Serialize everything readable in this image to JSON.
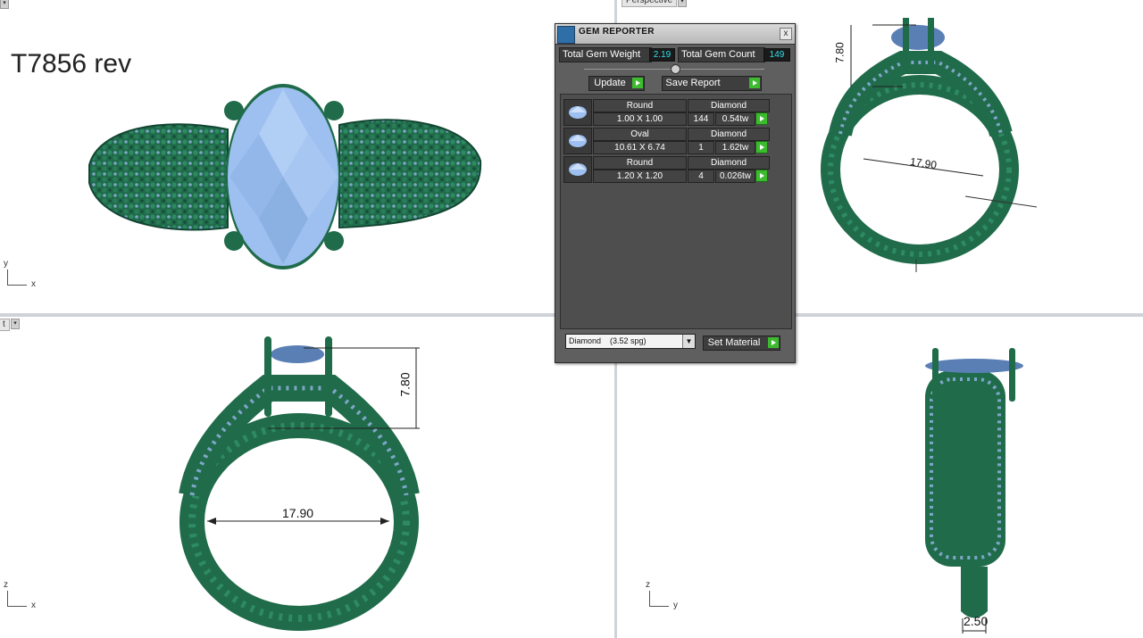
{
  "viewports": {
    "top": {
      "title": "T7856 rev",
      "axis_y": "y",
      "axis_x": "x"
    },
    "perspective": {
      "tab": "Perspective",
      "dim_height": "7.80",
      "dim_width": "17.90"
    },
    "front": {
      "tab": "t",
      "axis_y": "z",
      "axis_x": "x",
      "dim_height": "7.80",
      "dim_width": "17.90"
    },
    "right": {
      "axis_y": "z",
      "axis_x": "y",
      "dim_width": "2.50"
    }
  },
  "gem_reporter": {
    "title": "GEM REPORTER",
    "close_label": "x",
    "total_weight_label": "Total Gem Weight",
    "total_weight_value": "2.19",
    "total_count_label": "Total Gem Count",
    "total_count_value": "149",
    "update_label": "Update",
    "save_report_label": "Save Report",
    "gems": [
      {
        "shape": "Round",
        "size": "1.00 X 1.00",
        "material": "Diamond",
        "count": "144",
        "weight": "0.54tw"
      },
      {
        "shape": "Oval",
        "size": "10.61 X 6.74",
        "material": "Diamond",
        "count": "1",
        "weight": "1.62tw"
      },
      {
        "shape": "Round",
        "size": "1.20 X 1.20",
        "material": "Diamond",
        "count": "4",
        "weight": "0.026tw"
      }
    ],
    "material_select_value": "Diamond    (3.52 spg)",
    "set_material_label": "Set Material"
  },
  "colors": {
    "metal": "#1f6b4a",
    "metal_dark": "#124532",
    "gem": "#9ec0f0",
    "accent_green": "#3dbb2f",
    "value_text": "#2fe0e8"
  }
}
